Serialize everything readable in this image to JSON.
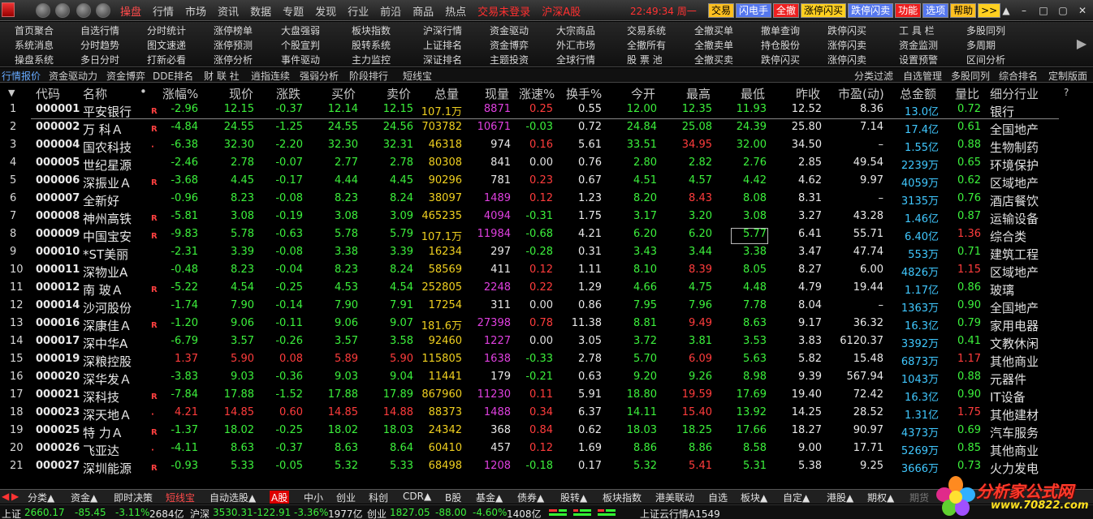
{
  "menu": {
    "items": [
      "操盘",
      "行情",
      "市场",
      "资讯",
      "数据",
      "专题",
      "发现",
      "行业",
      "前沿",
      "商品",
      "热点"
    ],
    "trade_status": "交易未登录",
    "market": "沪深A股",
    "clock": "22:49:34 周一"
  },
  "toolbar_buttons": [
    "交易",
    "闪电手",
    "全撤",
    "涨停闪买",
    "跌停闪卖",
    "功能",
    "选项",
    "帮助",
    ">>"
  ],
  "quick": [
    [
      "首页聚合",
      "系统消息",
      "操盘系统"
    ],
    [
      "自选行情",
      "分时趋势",
      "多日分时"
    ],
    [
      "分时统计",
      "图文速递",
      "打新必看"
    ],
    [
      "涨停榜单",
      "涨停预测",
      "涨停分析"
    ],
    [
      "大盘强弱",
      "个股宣判",
      "事件驱动"
    ],
    [
      "板块指数",
      "股转系统",
      "主力监控"
    ],
    [
      "沪深行情",
      "上证排名",
      "深证排名"
    ],
    [
      "资金驱动",
      "资金博弈",
      "主题投资"
    ],
    [
      "大宗商品",
      "外汇市场",
      "全球行情"
    ],
    [
      "交易系统",
      "全撤所有",
      "股 票 池"
    ],
    [
      "全撤买单",
      "全撤卖单",
      "全撤买卖"
    ],
    [
      "撤单查询",
      "持仓股份",
      "跌停闪买"
    ],
    [
      "跌停闪买",
      "涨停闪卖",
      "涨停闪卖"
    ],
    [
      "工 具 栏",
      "资金监测",
      "设置预警"
    ],
    [
      "多股同列",
      "多周期",
      "区间分析"
    ]
  ],
  "tabs_left": [
    "行情报价",
    "资金驱动力",
    "资金博弈",
    "DDE排名",
    "财 联 社",
    "逍指连续",
    "强弱分析",
    "阶段排行",
    "短线宝"
  ],
  "tabs_right": [
    "分类过滤",
    "自选管理",
    "多股同列",
    "综合排名",
    "定制版面"
  ],
  "columns": [
    "代码",
    "名称",
    "涨幅%",
    "现价",
    "涨跌",
    "买价",
    "卖价",
    "总量",
    "现量",
    "涨速%",
    "换手%",
    "今开",
    "最高",
    "最低",
    "昨收",
    "市盈(动)",
    "总金额",
    "量比",
    "细分行业"
  ],
  "rows": [
    {
      "n": "1",
      "code": "000001",
      "name": "平安银行",
      "m": "R",
      "chg": "-2.96",
      "price": "12.15",
      "diff": "-0.37",
      "bid": "12.14",
      "ask": "12.15",
      "vol": "107.1万",
      "cur": "8871",
      "spd": "0.25",
      "turn": "0.55",
      "open": "12.00",
      "high": "12.35",
      "low": "11.93",
      "prev": "12.52",
      "pe": "8.36",
      "amt": "13.0亿",
      "vr": "0.72",
      "ind": "银行"
    },
    {
      "n": "2",
      "code": "000002",
      "name": "万 科Ａ",
      "m": "R",
      "chg": "-4.84",
      "price": "24.55",
      "diff": "-1.25",
      "bid": "24.55",
      "ask": "24.56",
      "vol": "703782",
      "cur": "10671",
      "spd": "-0.03",
      "turn": "0.72",
      "open": "24.84",
      "high": "25.08",
      "low": "24.39",
      "prev": "25.80",
      "pe": "7.14",
      "amt": "17.4亿",
      "vr": "0.61",
      "ind": "全国地产"
    },
    {
      "n": "3",
      "code": "000004",
      "name": "国农科技",
      "m": "·",
      "chg": "-6.38",
      "price": "32.30",
      "diff": "-2.20",
      "bid": "32.30",
      "ask": "32.31",
      "vol": "46318",
      "cur": "974",
      "spd": "0.16",
      "turn": "5.61",
      "open": "33.51",
      "high": "34.95",
      "low": "32.00",
      "prev": "34.50",
      "pe": "–",
      "amt": "1.55亿",
      "vr": "0.88",
      "ind": "生物制药"
    },
    {
      "n": "4",
      "code": "000005",
      "name": "世纪星源",
      "m": "",
      "chg": "-2.46",
      "price": "2.78",
      "diff": "-0.07",
      "bid": "2.77",
      "ask": "2.78",
      "vol": "80308",
      "cur": "841",
      "spd": "0.00",
      "turn": "0.76",
      "open": "2.80",
      "high": "2.82",
      "low": "2.76",
      "prev": "2.85",
      "pe": "49.54",
      "amt": "2239万",
      "vr": "0.65",
      "ind": "环境保护"
    },
    {
      "n": "5",
      "code": "000006",
      "name": "深振业Ａ",
      "m": "R",
      "chg": "-3.68",
      "price": "4.45",
      "diff": "-0.17",
      "bid": "4.44",
      "ask": "4.45",
      "vol": "90296",
      "cur": "781",
      "spd": "0.23",
      "turn": "0.67",
      "open": "4.51",
      "high": "4.57",
      "low": "4.42",
      "prev": "4.62",
      "pe": "9.97",
      "amt": "4059万",
      "vr": "0.62",
      "ind": "区域地产"
    },
    {
      "n": "6",
      "code": "000007",
      "name": "全新好",
      "m": "",
      "chg": "-0.96",
      "price": "8.23",
      "diff": "-0.08",
      "bid": "8.23",
      "ask": "8.24",
      "vol": "38097",
      "cur": "1489",
      "spd": "0.12",
      "turn": "1.23",
      "open": "8.20",
      "high": "8.43",
      "low": "8.08",
      "prev": "8.31",
      "pe": "–",
      "amt": "3135万",
      "vr": "0.76",
      "ind": "酒店餐饮"
    },
    {
      "n": "7",
      "code": "000008",
      "name": "神州高铁",
      "m": "R",
      "chg": "-5.81",
      "price": "3.08",
      "diff": "-0.19",
      "bid": "3.08",
      "ask": "3.09",
      "vol": "465235",
      "cur": "4094",
      "spd": "-0.31",
      "turn": "1.75",
      "open": "3.17",
      "high": "3.20",
      "low": "3.08",
      "prev": "3.27",
      "pe": "43.28",
      "amt": "1.46亿",
      "vr": "0.87",
      "ind": "运输设备"
    },
    {
      "n": "8",
      "code": "000009",
      "name": "中国宝安",
      "m": "R",
      "chg": "-9.83",
      "price": "5.78",
      "diff": "-0.63",
      "bid": "5.78",
      "ask": "5.79",
      "vol": "107.1万",
      "cur": "11984",
      "spd": "-0.68",
      "turn": "4.21",
      "open": "6.20",
      "high": "6.20",
      "low": "5.77",
      "prev": "6.41",
      "pe": "55.71",
      "amt": "6.40亿",
      "vr": "1.36",
      "ind": "综合类"
    },
    {
      "n": "9",
      "code": "000010",
      "name": "*ST美丽",
      "m": "",
      "chg": "-2.31",
      "price": "3.39",
      "diff": "-0.08",
      "bid": "3.38",
      "ask": "3.39",
      "vol": "16234",
      "cur": "297",
      "spd": "-0.28",
      "turn": "0.31",
      "open": "3.43",
      "high": "3.44",
      "low": "3.38",
      "prev": "3.47",
      "pe": "47.74",
      "amt": "553万",
      "vr": "0.71",
      "ind": "建筑工程"
    },
    {
      "n": "10",
      "code": "000011",
      "name": "深物业A",
      "m": "",
      "chg": "-0.48",
      "price": "8.23",
      "diff": "-0.04",
      "bid": "8.23",
      "ask": "8.24",
      "vol": "58569",
      "cur": "411",
      "spd": "0.12",
      "turn": "1.11",
      "open": "8.10",
      "high": "8.39",
      "low": "8.05",
      "prev": "8.27",
      "pe": "6.00",
      "amt": "4826万",
      "vr": "1.15",
      "ind": "区域地产"
    },
    {
      "n": "11",
      "code": "000012",
      "name": "南 玻Ａ",
      "m": "R",
      "chg": "-5.22",
      "price": "4.54",
      "diff": "-0.25",
      "bid": "4.53",
      "ask": "4.54",
      "vol": "252805",
      "cur": "2248",
      "spd": "0.22",
      "turn": "1.29",
      "open": "4.66",
      "high": "4.75",
      "low": "4.48",
      "prev": "4.79",
      "pe": "19.44",
      "amt": "1.17亿",
      "vr": "0.86",
      "ind": "玻璃"
    },
    {
      "n": "12",
      "code": "000014",
      "name": "沙河股份",
      "m": "",
      "chg": "-1.74",
      "price": "7.90",
      "diff": "-0.14",
      "bid": "7.90",
      "ask": "7.91",
      "vol": "17254",
      "cur": "311",
      "spd": "0.00",
      "turn": "0.86",
      "open": "7.95",
      "high": "7.96",
      "low": "7.78",
      "prev": "8.04",
      "pe": "–",
      "amt": "1363万",
      "vr": "0.90",
      "ind": "全国地产"
    },
    {
      "n": "13",
      "code": "000016",
      "name": "深康佳Ａ",
      "m": "R",
      "chg": "-1.20",
      "price": "9.06",
      "diff": "-0.11",
      "bid": "9.06",
      "ask": "9.07",
      "vol": "181.6万",
      "cur": "27398",
      "spd": "0.78",
      "turn": "11.38",
      "open": "8.81",
      "high": "9.49",
      "low": "8.63",
      "prev": "9.17",
      "pe": "36.32",
      "amt": "16.3亿",
      "vr": "0.79",
      "ind": "家用电器"
    },
    {
      "n": "14",
      "code": "000017",
      "name": "深中华A",
      "m": "",
      "chg": "-6.79",
      "price": "3.57",
      "diff": "-0.26",
      "bid": "3.57",
      "ask": "3.58",
      "vol": "92460",
      "cur": "1227",
      "spd": "0.00",
      "turn": "3.05",
      "open": "3.72",
      "high": "3.81",
      "low": "3.53",
      "prev": "3.83",
      "pe": "6120.37",
      "amt": "3392万",
      "vr": "0.41",
      "ind": "文教休闲"
    },
    {
      "n": "15",
      "code": "000019",
      "name": "深粮控股",
      "m": "",
      "chg": "1.37",
      "price": "5.90",
      "diff": "0.08",
      "bid": "5.89",
      "ask": "5.90",
      "vol": "115805",
      "cur": "1638",
      "spd": "-0.33",
      "turn": "2.78",
      "open": "5.70",
      "high": "6.09",
      "low": "5.63",
      "prev": "5.82",
      "pe": "15.48",
      "amt": "6873万",
      "vr": "1.17",
      "ind": "其他商业"
    },
    {
      "n": "16",
      "code": "000020",
      "name": "深华发Ａ",
      "m": "",
      "chg": "-3.83",
      "price": "9.03",
      "diff": "-0.36",
      "bid": "9.03",
      "ask": "9.04",
      "vol": "11441",
      "cur": "179",
      "spd": "-0.21",
      "turn": "0.63",
      "open": "9.20",
      "high": "9.26",
      "low": "8.98",
      "prev": "9.39",
      "pe": "567.94",
      "amt": "1043万",
      "vr": "0.88",
      "ind": "元器件"
    },
    {
      "n": "17",
      "code": "000021",
      "name": "深科技",
      "m": "R",
      "chg": "-7.84",
      "price": "17.88",
      "diff": "-1.52",
      "bid": "17.88",
      "ask": "17.89",
      "vol": "867960",
      "cur": "11230",
      "spd": "0.11",
      "turn": "5.91",
      "open": "18.80",
      "high": "19.59",
      "low": "17.69",
      "prev": "19.40",
      "pe": "72.42",
      "amt": "16.3亿",
      "vr": "0.90",
      "ind": "IT设备"
    },
    {
      "n": "18",
      "code": "000023",
      "name": "深天地Ａ",
      "m": "·",
      "chg": "4.21",
      "price": "14.85",
      "diff": "0.60",
      "bid": "14.85",
      "ask": "14.88",
      "vol": "88373",
      "cur": "1488",
      "spd": "0.34",
      "turn": "6.37",
      "open": "14.11",
      "high": "15.40",
      "low": "13.92",
      "prev": "14.25",
      "pe": "28.52",
      "amt": "1.31亿",
      "vr": "1.75",
      "ind": "其他建材"
    },
    {
      "n": "19",
      "code": "000025",
      "name": "特 力Ａ",
      "m": "R",
      "chg": "-1.37",
      "price": "18.02",
      "diff": "-0.25",
      "bid": "18.02",
      "ask": "18.03",
      "vol": "24342",
      "cur": "368",
      "spd": "0.84",
      "turn": "0.62",
      "open": "18.03",
      "high": "18.25",
      "low": "17.66",
      "prev": "18.27",
      "pe": "90.97",
      "amt": "4373万",
      "vr": "0.69",
      "ind": "汽车服务"
    },
    {
      "n": "20",
      "code": "000026",
      "name": "飞亚达",
      "m": "·",
      "chg": "-4.11",
      "price": "8.63",
      "diff": "-0.37",
      "bid": "8.63",
      "ask": "8.64",
      "vol": "60410",
      "cur": "457",
      "spd": "0.12",
      "turn": "1.69",
      "open": "8.86",
      "high": "8.86",
      "low": "8.58",
      "prev": "9.00",
      "pe": "17.71",
      "amt": "5269万",
      "vr": "0.85",
      "ind": "其他商业"
    },
    {
      "n": "21",
      "code": "000027",
      "name": "深圳能源",
      "m": "R",
      "chg": "-0.93",
      "price": "5.33",
      "diff": "-0.05",
      "bid": "5.32",
      "ask": "5.33",
      "vol": "68498",
      "cur": "1208",
      "spd": "-0.18",
      "turn": "0.17",
      "open": "5.32",
      "high": "5.41",
      "low": "5.31",
      "prev": "5.38",
      "pe": "9.25",
      "amt": "3666万",
      "vr": "0.73",
      "ind": "火力发电"
    }
  ],
  "bottom_tabs": [
    "分类▲",
    "资金▲",
    "即时决策",
    "短线宝",
    "自动选股▲",
    "A股",
    "中小",
    "创业",
    "科创",
    "CDR▲",
    "B股",
    "基金▲",
    "债券▲",
    "股转▲",
    "板块指数",
    "港美联动",
    "自选",
    "板块▲",
    "自定▲",
    "港股▲",
    "期权▲",
    "期货"
  ],
  "status": {
    "sh_label": "上证",
    "sh_val": "2660.17",
    "sh_diff": "-85.45",
    "sh_pct": "-3.11%",
    "sh_amt": "2684亿",
    "hs_label": "沪深",
    "hs_val": "3530.31",
    "hs_diff": "-122.91",
    "hs_pct": "-3.36%",
    "hs_amt": "1977亿",
    "cy_label": "创业",
    "cy_val": "1827.05",
    "cy_diff": "-88.00",
    "cy_pct": "-4.60%",
    "cy_amt": "1408亿",
    "server": "上证云行情A1549"
  },
  "watermark": {
    "name": "分析家公式网",
    "url": "www.70822.com"
  }
}
